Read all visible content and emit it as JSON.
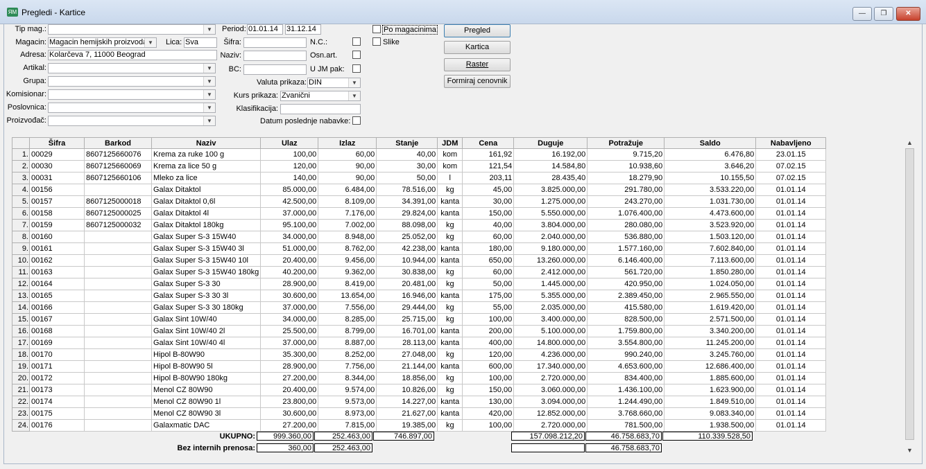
{
  "window": {
    "title": "Pregledi - Kartice",
    "min": "—",
    "max": "❐",
    "close": "✕"
  },
  "filters": {
    "tip_mag_label": "Tip mag.:",
    "tip_mag_value": "",
    "magacin_label": "Magacin:",
    "magacin_value": "Magacin hemijskih proizvoda",
    "lica_label": "Lica:",
    "lica_value": "Sva",
    "adresa_label": "Adresa:",
    "adresa_value": "Kolarčeva 7, 11000 Beograd",
    "artikal_label": "Artikal:",
    "grupa_label": "Grupa:",
    "komisionar_label": "Komisionar:",
    "poslovnica_label": "Poslovnica:",
    "proizvodjac_label": "Proizvođač:",
    "period_label": "Period:",
    "period_from": "01.01.14",
    "period_to": "31.12.14",
    "sifra_label": "Šifra:",
    "naziv_label": "Naziv:",
    "bc_label": "BC:",
    "nc_label": "N.C.:",
    "osn_art_label": "Osn.art.",
    "ujm_label": "U JM pak:",
    "valuta_label": "Valuta prikaza:",
    "valuta_value": "DIN",
    "kurs_label": "Kurs prikaza:",
    "kurs_value": "Zvanični",
    "klasifikacija_label": "Klasifikacija:",
    "datum_label": "Datum poslednje nabavke:",
    "po_magacinima": "Po magacinima",
    "slike": "Slike"
  },
  "buttons": {
    "pregled": "Pregled",
    "kartica": "Kartica",
    "raster": "Raster",
    "formiraj": "Formiraj cenovnik"
  },
  "table": {
    "columns": [
      "Šifra",
      "Barkod",
      "Naziv",
      "Ulaz",
      "Izlaz",
      "Stanje",
      "JDM",
      "Cena",
      "Duguje",
      "Potražuje",
      "Saldo",
      "Nabavljeno"
    ],
    "rows": [
      [
        "1.",
        "00029",
        "8607125660076",
        "Krema za ruke 100 g",
        "100,00",
        "60,00",
        "40,00",
        "kom",
        "161,92",
        "16.192,00",
        "9.715,20",
        "6.476,80",
        "23.01.15"
      ],
      [
        "2.",
        "00030",
        "8607125660069",
        "Krema za lice 50 g",
        "120,00",
        "90,00",
        "30,00",
        "kom",
        "121,54",
        "14.584,80",
        "10.938,60",
        "3.646,20",
        "07.02.15"
      ],
      [
        "3.",
        "00031",
        "8607125660106",
        "Mleko za lice",
        "140,00",
        "90,00",
        "50,00",
        "l",
        "203,11",
        "28.435,40",
        "18.279,90",
        "10.155,50",
        "07.02.15"
      ],
      [
        "4.",
        "00156",
        "",
        "Galax Ditaktol",
        "85.000,00",
        "6.484,00",
        "78.516,00",
        "kg",
        "45,00",
        "3.825.000,00",
        "291.780,00",
        "3.533.220,00",
        "01.01.14"
      ],
      [
        "5.",
        "00157",
        "8607125000018",
        "Galax Ditaktol 0,6l",
        "42.500,00",
        "8.109,00",
        "34.391,00",
        "kanta",
        "30,00",
        "1.275.000,00",
        "243.270,00",
        "1.031.730,00",
        "01.01.14"
      ],
      [
        "6.",
        "00158",
        "8607125000025",
        "Galax Ditaktol 4l",
        "37.000,00",
        "7.176,00",
        "29.824,00",
        "kanta",
        "150,00",
        "5.550.000,00",
        "1.076.400,00",
        "4.473.600,00",
        "01.01.14"
      ],
      [
        "7.",
        "00159",
        "8607125000032",
        "Galax Ditaktol 180kg",
        "95.100,00",
        "7.002,00",
        "88.098,00",
        "kg",
        "40,00",
        "3.804.000,00",
        "280.080,00",
        "3.523.920,00",
        "01.01.14"
      ],
      [
        "8.",
        "00160",
        "",
        "Galax Super S-3 15W40",
        "34.000,00",
        "8.948,00",
        "25.052,00",
        "kg",
        "60,00",
        "2.040.000,00",
        "536.880,00",
        "1.503.120,00",
        "01.01.14"
      ],
      [
        "9.",
        "00161",
        "",
        "Galax Super S-3 15W40 3l",
        "51.000,00",
        "8.762,00",
        "42.238,00",
        "kanta",
        "180,00",
        "9.180.000,00",
        "1.577.160,00",
        "7.602.840,00",
        "01.01.14"
      ],
      [
        "10.",
        "00162",
        "",
        "Galax Super S-3 15W40 10l",
        "20.400,00",
        "9.456,00",
        "10.944,00",
        "kanta",
        "650,00",
        "13.260.000,00",
        "6.146.400,00",
        "7.113.600,00",
        "01.01.14"
      ],
      [
        "11.",
        "00163",
        "",
        "Galax Super S-3 15W40 180kg",
        "40.200,00",
        "9.362,00",
        "30.838,00",
        "kg",
        "60,00",
        "2.412.000,00",
        "561.720,00",
        "1.850.280,00",
        "01.01.14"
      ],
      [
        "12.",
        "00164",
        "",
        "Galax Super S-3 30",
        "28.900,00",
        "8.419,00",
        "20.481,00",
        "kg",
        "50,00",
        "1.445.000,00",
        "420.950,00",
        "1.024.050,00",
        "01.01.14"
      ],
      [
        "13.",
        "00165",
        "",
        "Galax Super S-3 30 3l",
        "30.600,00",
        "13.654,00",
        "16.946,00",
        "kanta",
        "175,00",
        "5.355.000,00",
        "2.389.450,00",
        "2.965.550,00",
        "01.01.14"
      ],
      [
        "14.",
        "00166",
        "",
        "Galax Super S-3 30 180kg",
        "37.000,00",
        "7.556,00",
        "29.444,00",
        "kg",
        "55,00",
        "2.035.000,00",
        "415.580,00",
        "1.619.420,00",
        "01.01.14"
      ],
      [
        "15.",
        "00167",
        "",
        "Galax Sint 10W/40",
        "34.000,00",
        "8.285,00",
        "25.715,00",
        "kg",
        "100,00",
        "3.400.000,00",
        "828.500,00",
        "2.571.500,00",
        "01.01.14"
      ],
      [
        "16.",
        "00168",
        "",
        "Galax Sint 10W/40 2l",
        "25.500,00",
        "8.799,00",
        "16.701,00",
        "kanta",
        "200,00",
        "5.100.000,00",
        "1.759.800,00",
        "3.340.200,00",
        "01.01.14"
      ],
      [
        "17.",
        "00169",
        "",
        "Galax Sint 10W/40 4l",
        "37.000,00",
        "8.887,00",
        "28.113,00",
        "kanta",
        "400,00",
        "14.800.000,00",
        "3.554.800,00",
        "11.245.200,00",
        "01.01.14"
      ],
      [
        "18.",
        "00170",
        "",
        "Hipol B-80W90",
        "35.300,00",
        "8.252,00",
        "27.048,00",
        "kg",
        "120,00",
        "4.236.000,00",
        "990.240,00",
        "3.245.760,00",
        "01.01.14"
      ],
      [
        "19.",
        "00171",
        "",
        "Hipol B-80W90 5l",
        "28.900,00",
        "7.756,00",
        "21.144,00",
        "kanta",
        "600,00",
        "17.340.000,00",
        "4.653.600,00",
        "12.686.400,00",
        "01.01.14"
      ],
      [
        "20.",
        "00172",
        "",
        "Hipol B-80W90 180kg",
        "27.200,00",
        "8.344,00",
        "18.856,00",
        "kg",
        "100,00",
        "2.720.000,00",
        "834.400,00",
        "1.885.600,00",
        "01.01.14"
      ],
      [
        "21.",
        "00173",
        "",
        "Menol CZ 80W90",
        "20.400,00",
        "9.574,00",
        "10.826,00",
        "kg",
        "150,00",
        "3.060.000,00",
        "1.436.100,00",
        "1.623.900,00",
        "01.01.14"
      ],
      [
        "22.",
        "00174",
        "",
        "Menol CZ 80W90 1l",
        "23.800,00",
        "9.573,00",
        "14.227,00",
        "kanta",
        "130,00",
        "3.094.000,00",
        "1.244.490,00",
        "1.849.510,00",
        "01.01.14"
      ],
      [
        "23.",
        "00175",
        "",
        "Menol CZ 80W90 3l",
        "30.600,00",
        "8.973,00",
        "21.627,00",
        "kanta",
        "420,00",
        "12.852.000,00",
        "3.768.660,00",
        "9.083.340,00",
        "01.01.14"
      ],
      [
        "24.",
        "00176",
        "",
        "Galaxmatic DAC",
        "27.200,00",
        "7.815,00",
        "19.385,00",
        "kg",
        "100,00",
        "2.720.000,00",
        "781.500,00",
        "1.938.500,00",
        "01.01.14"
      ]
    ]
  },
  "totals": {
    "ukupno_label": "UKUPNO:",
    "ulaz": "999.360,00",
    "izlaz": "252.463,00",
    "stanje": "746.897,00",
    "duguje": "157.098.212,20",
    "potrazuje": "46.758.683,70",
    "saldo": "110.339.528,50",
    "bez_label": "Bez internih prenosa:",
    "bez_ulaz": "360,00",
    "bez_izlaz": "252.463,00",
    "bez_duguje": "",
    "bez_potrazuje": "46.758.683,70"
  }
}
